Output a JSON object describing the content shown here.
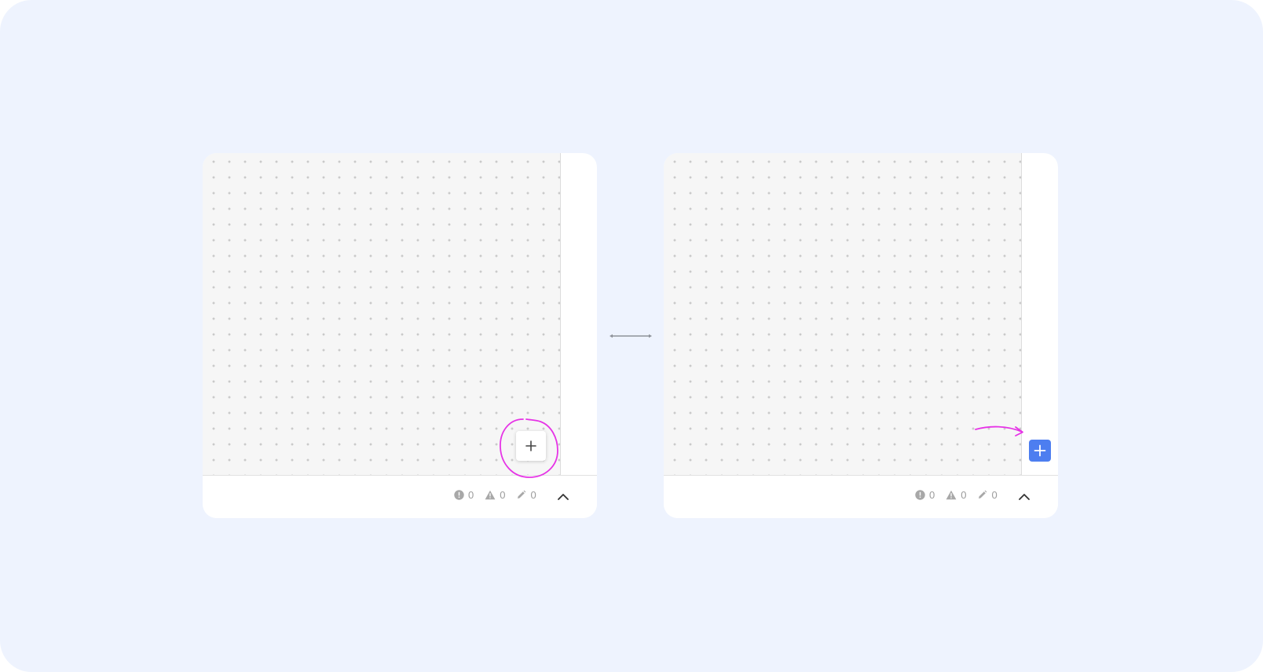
{
  "left_panel": {
    "status": {
      "errors": "0",
      "warnings": "0",
      "edits": "0"
    },
    "add_button_icon": "plus-icon",
    "collapse_icon": "chevron-up-icon"
  },
  "right_panel": {
    "status": {
      "errors": "0",
      "warnings": "0",
      "edits": "0"
    },
    "add_button_icon": "plus-icon",
    "collapse_icon": "chevron-up-icon"
  },
  "colors": {
    "background": "#eef3fe",
    "canvas": "#f6f6f6",
    "accent_blue": "#4d7ef0",
    "annotation_magenta": "#e633e6",
    "status_gray": "#9b9b9b"
  },
  "annotations": {
    "left": "circle-highlight",
    "right": "arrow-pointer"
  }
}
